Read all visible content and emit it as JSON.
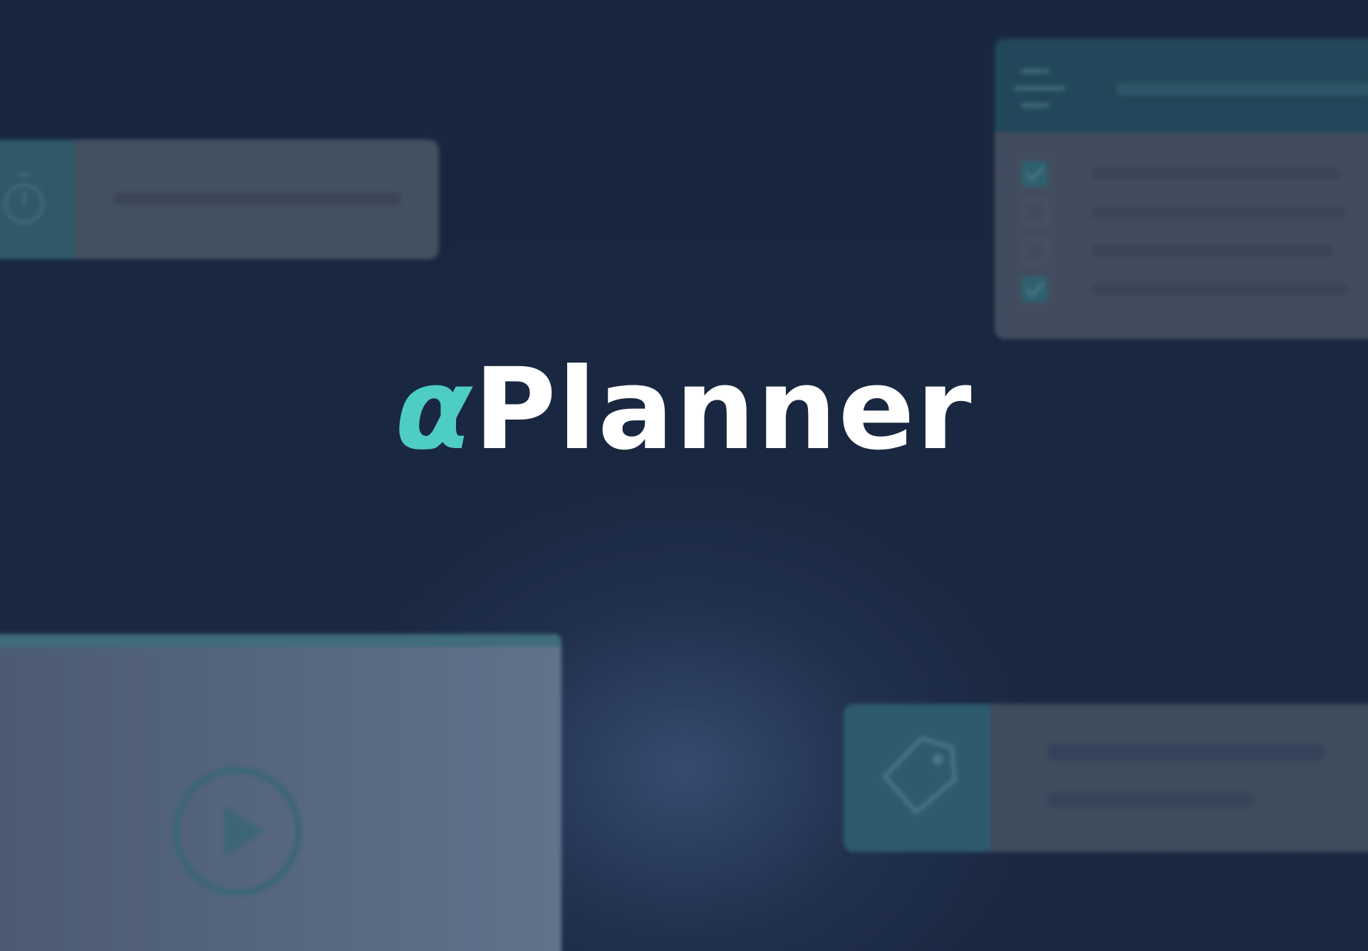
{
  "logo": {
    "prefix": "α",
    "name": "Planner"
  },
  "colors": {
    "background": "#19263f",
    "accent": "#4ecdc4",
    "logo_text": "#ffffff",
    "card_teal": "#2f5868",
    "card_grey": "#435061"
  },
  "decor": {
    "timer_card": {
      "icon": "stopwatch-icon"
    },
    "checklist_card": {
      "header_icon": "menu-icon",
      "items": [
        {
          "checked": true
        },
        {
          "checked": false
        },
        {
          "checked": false
        },
        {
          "checked": true
        }
      ]
    },
    "video_card": {
      "icon": "play-icon"
    },
    "tag_card": {
      "icon": "tag-icon"
    }
  }
}
